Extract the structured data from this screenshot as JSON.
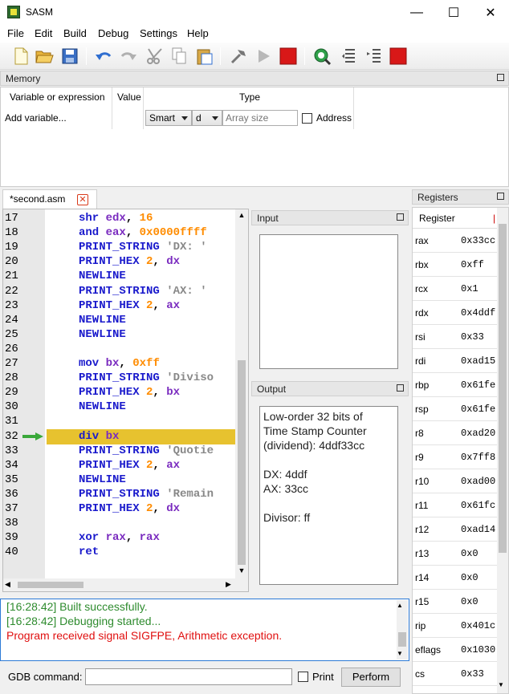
{
  "window": {
    "title": "SASM",
    "minimize": "—",
    "maximize": "☐",
    "close": "✕"
  },
  "menu": [
    "File",
    "Edit",
    "Build",
    "Debug",
    "Settings",
    "Help"
  ],
  "memory": {
    "title": "Memory",
    "col_variable": "Variable or expression",
    "col_value": "Value",
    "col_type": "Type",
    "add_variable": "Add variable...",
    "type_combo": "Smart",
    "format_combo": "d",
    "array_size_placeholder": "Array size",
    "address_label": "Address"
  },
  "tab": {
    "label": "*second.asm",
    "close": "✕"
  },
  "editor": {
    "lines": [
      {
        "n": "17",
        "tokens": [
          [
            "kw",
            "shr "
          ],
          [
            "reg",
            "edx"
          ],
          [
            "",
            ","
          ],
          [
            "num",
            " 16"
          ]
        ]
      },
      {
        "n": "18",
        "tokens": [
          [
            "kw",
            "and "
          ],
          [
            "reg",
            "eax"
          ],
          [
            "",
            ", "
          ],
          [
            "num",
            "0x0000ffff"
          ]
        ]
      },
      {
        "n": "19",
        "tokens": [
          [
            "kw",
            "PRINT_STRING "
          ],
          [
            "str",
            "'DX: '"
          ]
        ]
      },
      {
        "n": "20",
        "tokens": [
          [
            "kw",
            "PRINT_HEX "
          ],
          [
            "num",
            "2"
          ],
          [
            "",
            ", "
          ],
          [
            "reg",
            "dx"
          ]
        ]
      },
      {
        "n": "21",
        "tokens": [
          [
            "kw",
            "NEWLINE"
          ]
        ]
      },
      {
        "n": "22",
        "tokens": [
          [
            "kw",
            "PRINT_STRING "
          ],
          [
            "str",
            "'AX: '"
          ]
        ]
      },
      {
        "n": "23",
        "tokens": [
          [
            "kw",
            "PRINT_HEX "
          ],
          [
            "num",
            "2"
          ],
          [
            "",
            ", "
          ],
          [
            "reg",
            "ax"
          ]
        ]
      },
      {
        "n": "24",
        "tokens": [
          [
            "kw",
            "NEWLINE"
          ]
        ]
      },
      {
        "n": "25",
        "tokens": [
          [
            "kw",
            "NEWLINE"
          ]
        ]
      },
      {
        "n": "26",
        "tokens": []
      },
      {
        "n": "27",
        "tokens": [
          [
            "kw",
            "mov "
          ],
          [
            "reg",
            "bx"
          ],
          [
            "",
            ", "
          ],
          [
            "num",
            "0xff"
          ]
        ]
      },
      {
        "n": "28",
        "tokens": [
          [
            "kw",
            "PRINT_STRING "
          ],
          [
            "str",
            "'Diviso"
          ]
        ]
      },
      {
        "n": "29",
        "tokens": [
          [
            "kw",
            "PRINT_HEX "
          ],
          [
            "num",
            "2"
          ],
          [
            "",
            ", "
          ],
          [
            "reg",
            "bx"
          ]
        ]
      },
      {
        "n": "30",
        "tokens": [
          [
            "kw",
            "NEWLINE"
          ]
        ]
      },
      {
        "n": "31",
        "tokens": []
      },
      {
        "n": "32",
        "tokens": [
          [
            "kw",
            "div "
          ],
          [
            "reg",
            "bx"
          ]
        ]
      },
      {
        "n": "33",
        "tokens": [
          [
            "kw",
            "PRINT_STRING "
          ],
          [
            "str",
            "'Quotie"
          ]
        ]
      },
      {
        "n": "34",
        "tokens": [
          [
            "kw",
            "PRINT_HEX "
          ],
          [
            "num",
            "2"
          ],
          [
            "",
            ", "
          ],
          [
            "reg",
            "ax"
          ]
        ]
      },
      {
        "n": "35",
        "tokens": [
          [
            "kw",
            "NEWLINE"
          ]
        ]
      },
      {
        "n": "36",
        "tokens": [
          [
            "kw",
            "PRINT_STRING "
          ],
          [
            "str",
            "'Remain"
          ]
        ]
      },
      {
        "n": "37",
        "tokens": [
          [
            "kw",
            "PRINT_HEX "
          ],
          [
            "num",
            "2"
          ],
          [
            "",
            ", "
          ],
          [
            "reg",
            "dx"
          ]
        ]
      },
      {
        "n": "38",
        "tokens": []
      },
      {
        "n": "39",
        "tokens": [
          [
            "kw",
            "xor "
          ],
          [
            "reg",
            "rax"
          ],
          [
            "",
            ", "
          ],
          [
            "reg",
            "rax"
          ]
        ]
      },
      {
        "n": "40",
        "tokens": [
          [
            "kw",
            "ret"
          ]
        ]
      }
    ]
  },
  "input_panel": {
    "title": "Input"
  },
  "output_panel": {
    "title": "Output",
    "text": "Low-order 32 bits of\nTime Stamp Counter\n(dividend): 4ddf33cc\n\nDX: 4ddf\nAX: 33cc\n\nDivisor: ff"
  },
  "log": [
    {
      "text": "[16:28:42] Built successfully.",
      "color": "#2e8b2e"
    },
    {
      "text": "[16:28:42] Debugging started...",
      "color": "#2e8b2e"
    },
    {
      "text": "Program received signal SIGFPE, Arithmetic exception.",
      "color": "#e01010"
    }
  ],
  "gdb": {
    "label": "GDB command:",
    "print_label": "Print",
    "perform_label": "Perform"
  },
  "registers": {
    "title": "Registers",
    "col_register": "Register",
    "rows": [
      {
        "name": "rax",
        "value": "0x33cc"
      },
      {
        "name": "rbx",
        "value": "0xff"
      },
      {
        "name": "rcx",
        "value": "0x1"
      },
      {
        "name": "rdx",
        "value": "0x4ddf"
      },
      {
        "name": "rsi",
        "value": "0x33"
      },
      {
        "name": "rdi",
        "value": "0xad15"
      },
      {
        "name": "rbp",
        "value": "0x61fe"
      },
      {
        "name": "rsp",
        "value": "0x61fe"
      },
      {
        "name": "r8",
        "value": "0xad20"
      },
      {
        "name": "r9",
        "value": "0x7ff8"
      },
      {
        "name": "r10",
        "value": "0xad00"
      },
      {
        "name": "r11",
        "value": "0x61fc"
      },
      {
        "name": "r12",
        "value": "0xad14"
      },
      {
        "name": "r13",
        "value": "0x0"
      },
      {
        "name": "r14",
        "value": "0x0"
      },
      {
        "name": "r15",
        "value": "0x0"
      },
      {
        "name": "rip",
        "value": "0x401c"
      },
      {
        "name": "eflags",
        "value": "0x1030"
      },
      {
        "name": "cs",
        "value": "0x33"
      }
    ]
  }
}
